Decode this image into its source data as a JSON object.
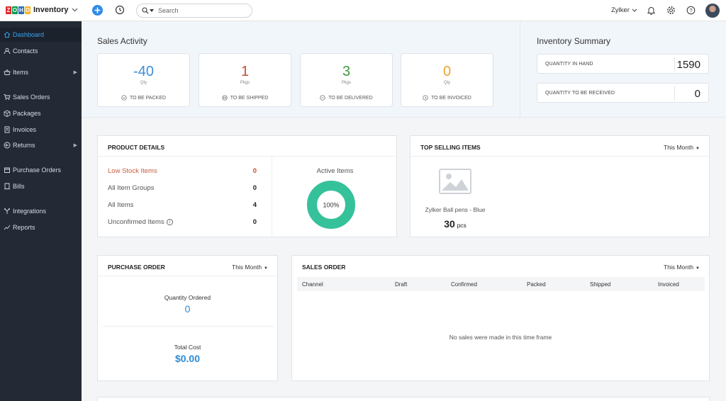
{
  "app": {
    "logo_letters": [
      "Z",
      "O",
      "H",
      "O"
    ],
    "logo_colors": [
      "#e42527",
      "#089949",
      "#226db4",
      "#f9b21d"
    ],
    "name": "Inventory",
    "search_placeholder": "Search",
    "org_name": "Zylker"
  },
  "sidebar": {
    "items": [
      {
        "label": "Dashboard",
        "icon": "home-icon",
        "active": true
      },
      {
        "label": "Contacts",
        "icon": "person-icon"
      },
      {
        "label": "Items",
        "icon": "basket-icon",
        "has_submenu": true
      },
      {
        "label": "Sales Orders",
        "icon": "cart-icon"
      },
      {
        "label": "Packages",
        "icon": "package-icon"
      },
      {
        "label": "Invoices",
        "icon": "invoice-icon"
      },
      {
        "label": "Returns",
        "icon": "return-icon",
        "has_submenu": true
      },
      {
        "label": "Purchase Orders",
        "icon": "purchase-icon"
      },
      {
        "label": "Bills",
        "icon": "bill-icon"
      },
      {
        "label": "Integrations",
        "icon": "integrations-icon"
      },
      {
        "label": "Reports",
        "icon": "reports-icon"
      }
    ]
  },
  "sales_activity": {
    "title": "Sales Activity",
    "cards": [
      {
        "value": "-40",
        "unit": "Qty",
        "label": "TO BE PACKED",
        "color": "#3b8fd9"
      },
      {
        "value": "1",
        "unit": "Pkgs",
        "label": "TO BE SHIPPED",
        "color": "#c0503a"
      },
      {
        "value": "3",
        "unit": "Pkgs",
        "label": "TO BE DELIVERED",
        "color": "#3f9a3f"
      },
      {
        "value": "0",
        "unit": "Qty",
        "label": "TO BE INVOICED",
        "color": "#f0a22e"
      }
    ]
  },
  "inventory_summary": {
    "title": "Inventory Summary",
    "rows": [
      {
        "label": "QUANTITY IN HAND",
        "value": "1590"
      },
      {
        "label": "QUANTITY TO BE RECEIVED",
        "value": "0"
      }
    ]
  },
  "product_details": {
    "title": "PRODUCT DETAILS",
    "rows": [
      {
        "label": "Low Stock Items",
        "value": "0"
      },
      {
        "label": "All Item Groups",
        "value": "0"
      },
      {
        "label": "All Items",
        "value": "4"
      },
      {
        "label": "Unconfirmed Items",
        "value": "0"
      }
    ],
    "active_items_title": "Active Items",
    "active_items_percent": "100%",
    "active_fraction": 1.0,
    "donut_color": "#35c29b"
  },
  "top_selling": {
    "title": "TOP SELLING ITEMS",
    "period": "This Month",
    "item_name": "Zylker Ball pens - Blue",
    "item_qty": "30",
    "item_unit": "pcs"
  },
  "purchase_order": {
    "title": "PURCHASE ORDER",
    "period": "This Month",
    "qty_label": "Quantity Ordered",
    "qty_value": "0",
    "cost_label": "Total Cost",
    "cost_value": "$0.00",
    "accent": "#2d8ad6"
  },
  "sales_order": {
    "title": "SALES ORDER",
    "period": "This Month",
    "columns": [
      "Channel",
      "Draft",
      "Confirmed",
      "Packed",
      "Shipped",
      "Invoiced"
    ],
    "empty_message": "No sales were made in this time frame"
  }
}
